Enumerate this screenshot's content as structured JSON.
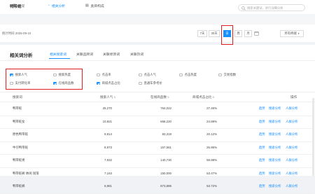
{
  "header": {
    "keyword": "鸭带蛇",
    "search_placeholder": "搜索关键词，进行详细分析"
  },
  "page_tabs": [
    {
      "label": "概况",
      "icon": "overview-icon"
    },
    {
      "label": "相关分析",
      "icon": "analysis-icon"
    },
    {
      "label": "类目构成",
      "icon": "category-icon"
    }
  ],
  "stat_period": "统计时间 2025-09-10",
  "date_buttons": [
    "7天",
    "30天",
    "日",
    "周",
    "月"
  ],
  "selected_date": "日",
  "all_channels": "所有终端",
  "section_title": "相关词分析",
  "sub_tabs": [
    "相关搜索词",
    "关联品牌词",
    "关联修饰词",
    "关联热词"
  ],
  "metrics": [
    {
      "label": "搜索人气",
      "checked": true
    },
    {
      "label": "搜索热度",
      "checked": false
    },
    {
      "label": "点击率",
      "checked": false
    },
    {
      "label": "点击人气",
      "checked": false
    },
    {
      "label": "点击热度",
      "checked": false
    },
    {
      "label": "交易指数",
      "checked": false
    },
    {
      "label": "支付转化率",
      "checked": false
    },
    {
      "label": "在线商品数",
      "checked": true
    },
    {
      "label": "商城点击占比",
      "checked": true
    },
    {
      "label": "直通车参考价",
      "checked": false
    }
  ],
  "table": {
    "headers": [
      "搜索词",
      "搜索人气",
      "在线商品数",
      "商城点击占比",
      "操作"
    ],
    "rows": [
      {
        "word": "鸭带蛇",
        "pop": "25,270",
        "goods": "764,022",
        "ratio": "27.46%"
      },
      {
        "word": "鸭带蛇女",
        "pop": "10,821",
        "goods": "668,220",
        "ratio": "24.88%"
      },
      {
        "word": "原色鸭带蛇",
        "pop": "9,814",
        "goods": "83,319",
        "ratio": "20.12%"
      },
      {
        "word": "牛仔鸭带蛇",
        "pop": "8,973",
        "goods": "157,561",
        "ratio": "26.86%"
      },
      {
        "word": "鸭带蛇男",
        "pop": "7,932",
        "goods": "140,730",
        "ratio": "59.88%"
      },
      {
        "word": "鸭带蛇裤 休闲 闯荡",
        "pop": "7,163",
        "goods": "150,000",
        "ratio": "53.47%"
      },
      {
        "word": "鸭带蛇裤",
        "pop": "6,981",
        "goods": "873,886",
        "ratio": "53.72%"
      }
    ],
    "actions": [
      "趋势",
      "搜索分析",
      "人群分析"
    ]
  }
}
